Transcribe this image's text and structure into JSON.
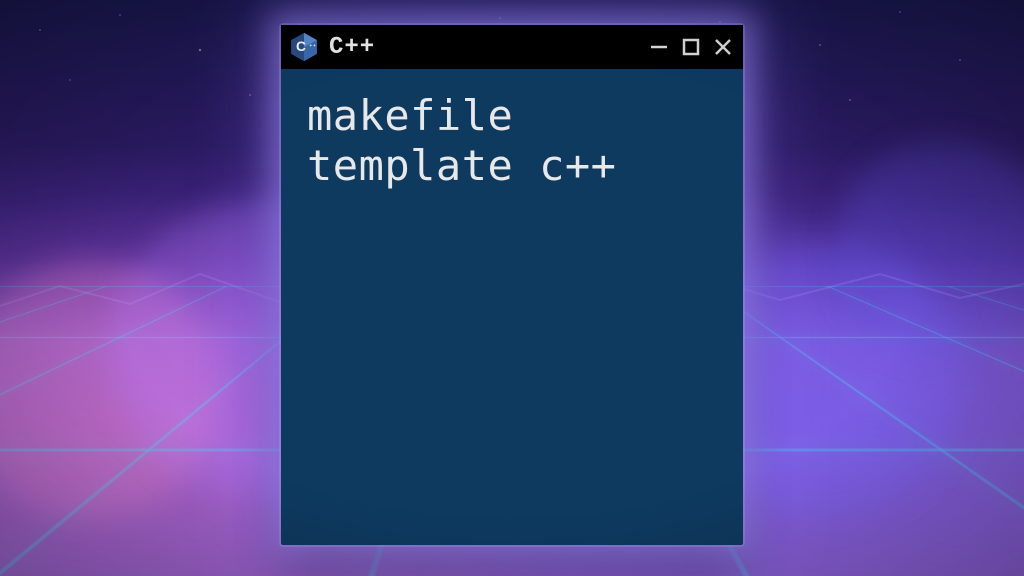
{
  "window": {
    "title": "C++",
    "content": "makefile\ntemplate c++",
    "logo_letter": "C",
    "logo_plus": "++"
  },
  "colors": {
    "window_bg": "#0e3a60",
    "titlebar_bg": "#000000",
    "text": "#e8e8e8",
    "logo_primary": "#3b6db3",
    "logo_dark": "#2a4e85",
    "logo_light": "#5a8fd6"
  }
}
